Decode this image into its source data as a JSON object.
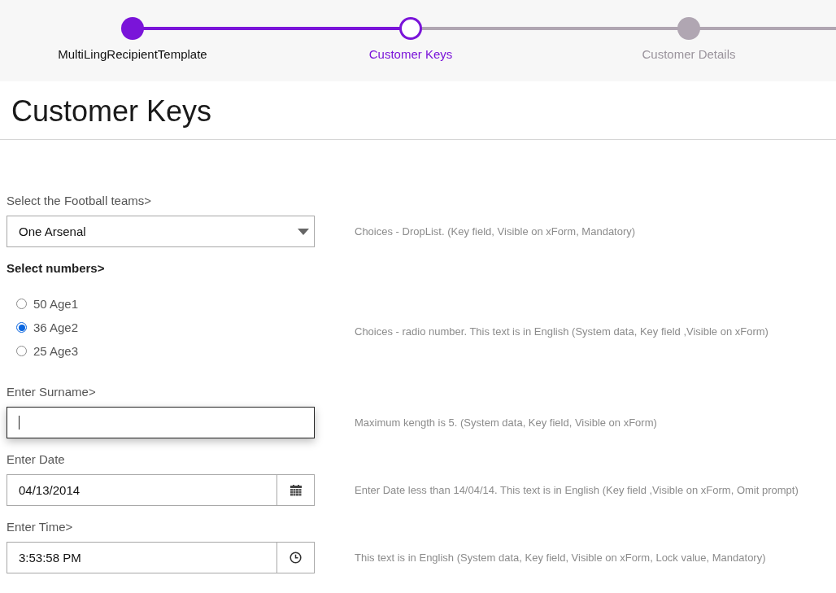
{
  "stepper": [
    {
      "label": "MultiLingRecipientTemplate",
      "completed": true,
      "selected": false
    },
    {
      "label": "Customer Keys",
      "completed": false,
      "selected": true
    },
    {
      "label": "Customer Details",
      "completed": false,
      "selected": false
    }
  ],
  "page_title": "Customer Keys",
  "fields": [
    {
      "kind": "dropdown",
      "label": "Select the Football teams>",
      "value": "One Arsenal",
      "hint": "Choices - DropList. (Key field, Visible on xForm, Mandatory)"
    },
    {
      "kind": "radio",
      "label": "Select numbers>",
      "options": [
        {
          "label": "50 Age1",
          "selected": false
        },
        {
          "label": "36 Age2",
          "selected": true
        },
        {
          "label": "25 Age3",
          "selected": false
        }
      ],
      "hint": "Choices - radio number. This text is in English (System data, Key field ,Visible on xForm)"
    },
    {
      "kind": "text",
      "label": "Enter Surname>",
      "focused": true,
      "hint": "Maximum kength is 5. (System data, Key field, Visible on xForm)"
    },
    {
      "kind": "date",
      "label": "Enter Date",
      "value": "04/13/2014",
      "hint": "Enter Date less than 14/04/14. This text is in English (Key field ,Visible on xForm, Omit prompt)"
    },
    {
      "kind": "time",
      "label": "Enter Time>",
      "value": "3:53:58 PM",
      "hint": "This text is in English (System data, Key field, Visible on xForm, Lock value, Mandatory)"
    }
  ]
}
